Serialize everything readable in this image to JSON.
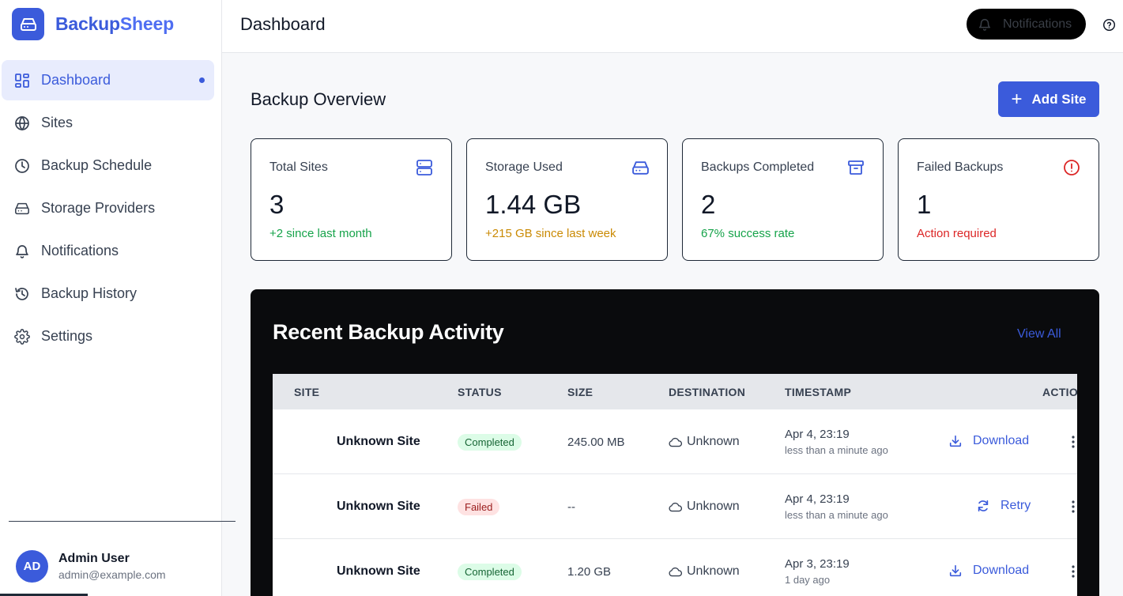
{
  "brand": {
    "name_part1": "Backup",
    "name_part2": "Sheep"
  },
  "nav": [
    {
      "label": "Dashboard",
      "icon": "dashboard-icon",
      "active": true
    },
    {
      "label": "Sites",
      "icon": "globe-icon"
    },
    {
      "label": "Backup Schedule",
      "icon": "clock-icon"
    },
    {
      "label": "Storage Providers",
      "icon": "hard-drive-icon"
    },
    {
      "label": "Notifications",
      "icon": "bell-icon"
    },
    {
      "label": "Backup History",
      "icon": "history-icon"
    },
    {
      "label": "Settings",
      "icon": "gear-icon"
    }
  ],
  "user": {
    "initials": "AD",
    "name": "Admin User",
    "email": "admin@example.com"
  },
  "header": {
    "title": "Dashboard",
    "notifications_label": "Notifications"
  },
  "overview": {
    "title": "Backup Overview",
    "add_site_label": "Add Site",
    "cards": [
      {
        "title": "Total Sites",
        "value": "3",
        "sub": "+2 since last month",
        "sub_color": "#16a34a",
        "icon": "server-icon"
      },
      {
        "title": "Storage Used",
        "value": "1.44 GB",
        "sub": "+215 GB since last week",
        "sub_color": "#ca8a04",
        "icon": "hard-drive-icon"
      },
      {
        "title": "Backups Completed",
        "value": "2",
        "sub": "67% success rate",
        "sub_color": "#16a34a",
        "icon": "archive-icon"
      },
      {
        "title": "Failed Backups",
        "value": "1",
        "sub": "Action required",
        "sub_color": "#dc2626",
        "icon": "alert-circle-icon"
      }
    ]
  },
  "activity": {
    "title": "Recent Backup Activity",
    "view_all": "View All",
    "columns": [
      "SITE",
      "STATUS",
      "SIZE",
      "DESTINATION",
      "TIMESTAMP",
      "ACTIONS"
    ],
    "rows": [
      {
        "site": "Unknown Site",
        "status": "Completed",
        "status_type": "ok",
        "size": "245.00 MB",
        "destination": "Unknown",
        "timestamp": "Apr 4, 23:19",
        "relative": "less than a minute ago",
        "action": "Download",
        "action_icon": "download-icon"
      },
      {
        "site": "Unknown Site",
        "status": "Failed",
        "status_type": "fail",
        "size": "--",
        "destination": "Unknown",
        "timestamp": "Apr 4, 23:19",
        "relative": "less than a minute ago",
        "action": "Retry",
        "action_icon": "refresh-icon"
      },
      {
        "site": "Unknown Site",
        "status": "Completed",
        "status_type": "ok",
        "size": "1.20 GB",
        "destination": "Unknown",
        "timestamp": "Apr 3, 23:19",
        "relative": "1 day ago",
        "action": "Download",
        "action_icon": "download-icon"
      }
    ]
  },
  "colors": {
    "accent": "#3b5bdb",
    "success": "#16a34a",
    "warning": "#ca8a04",
    "danger": "#dc2626"
  }
}
